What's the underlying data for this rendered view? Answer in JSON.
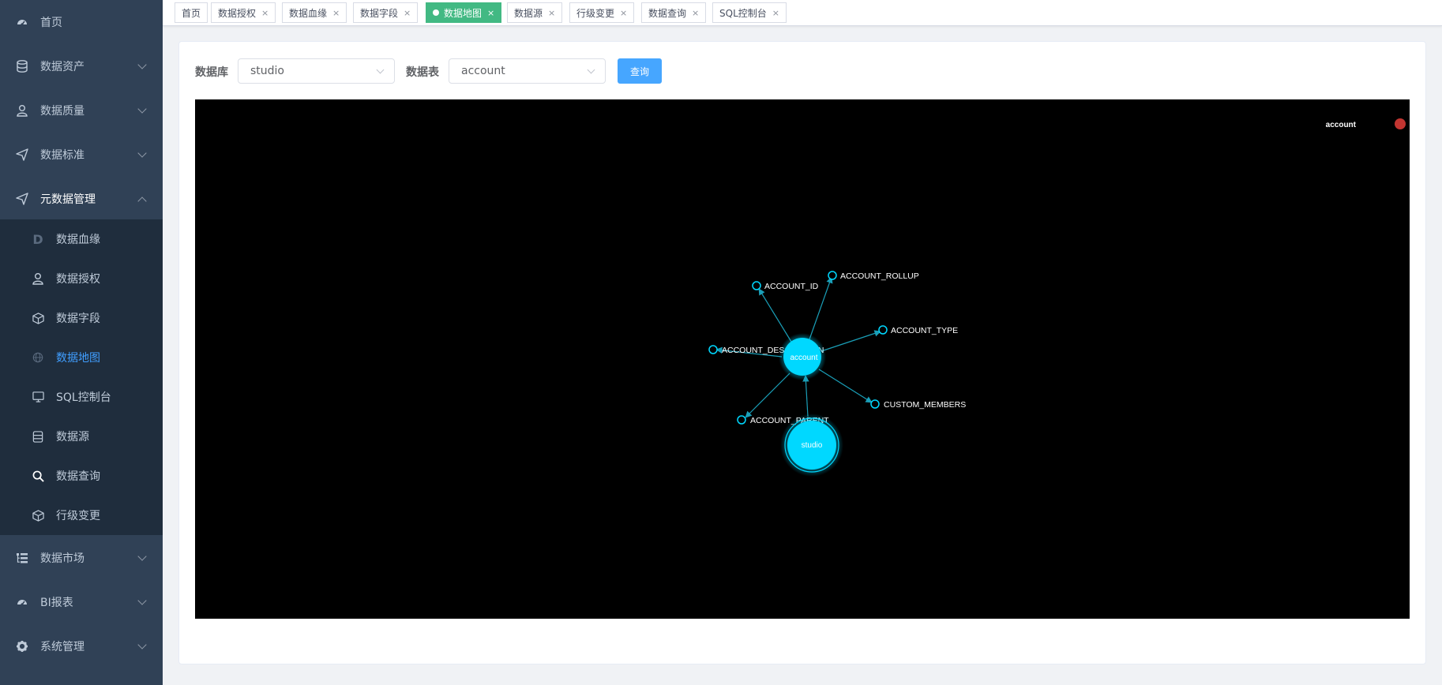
{
  "sidebar": {
    "items": [
      {
        "label": "首页",
        "icon": "dashboard-icon",
        "has_arrow": false
      },
      {
        "label": "数据资产",
        "icon": "database-icon",
        "has_arrow": true
      },
      {
        "label": "数据质量",
        "icon": "user-icon",
        "has_arrow": true
      },
      {
        "label": "数据标准",
        "icon": "send-icon",
        "has_arrow": true
      },
      {
        "label": "元数据管理",
        "icon": "send-icon",
        "has_arrow": true,
        "open": true
      },
      {
        "label": "数据市场",
        "icon": "tree-icon",
        "has_arrow": true
      },
      {
        "label": "BI报表",
        "icon": "dashboard-icon",
        "has_arrow": true
      },
      {
        "label": "系统管理",
        "icon": "gear-icon",
        "has_arrow": true
      }
    ],
    "submenu": [
      {
        "label": "数据血缘",
        "icon": "letter-d-icon"
      },
      {
        "label": "数据授权",
        "icon": "user-icon"
      },
      {
        "label": "数据字段",
        "icon": "cube-icon"
      },
      {
        "label": "数据地图",
        "icon": "globe-icon",
        "active": true
      },
      {
        "label": "SQL控制台",
        "icon": "monitor-icon"
      },
      {
        "label": "数据源",
        "icon": "database-icon"
      },
      {
        "label": "数据查询",
        "icon": "search-icon"
      },
      {
        "label": "行级变更",
        "icon": "cube-icon"
      }
    ]
  },
  "tags": [
    {
      "label": "首页",
      "closable": false
    },
    {
      "label": "数据授权",
      "closable": true
    },
    {
      "label": "数据血缘",
      "closable": true
    },
    {
      "label": "数据字段",
      "closable": true
    },
    {
      "label": "数据地图",
      "closable": true,
      "active": true
    },
    {
      "label": "数据源",
      "closable": true
    },
    {
      "label": "行级变更",
      "closable": true
    },
    {
      "label": "数据查询",
      "closable": true
    },
    {
      "label": "SQL控制台",
      "closable": true
    }
  ],
  "tag_close_glyph": "×",
  "form": {
    "db_label": "数据库",
    "db_value": "studio",
    "table_label": "数据表",
    "table_value": "account",
    "query_button": "查询"
  },
  "graph": {
    "legend_label": "account",
    "legend_color": "#c23531",
    "node_color": "#00d8ff",
    "edge_color": "#1a9fb8",
    "center_node": "account",
    "root_node": "studio",
    "fields": [
      "ACCOUNT_ID",
      "ACCOUNT_ROLLUP",
      "ACCOUNT_TYPE",
      "ACCOUNT_DESCRIPTION",
      "CUSTOM_MEMBERS",
      "ACCOUNT_PARENT"
    ]
  }
}
